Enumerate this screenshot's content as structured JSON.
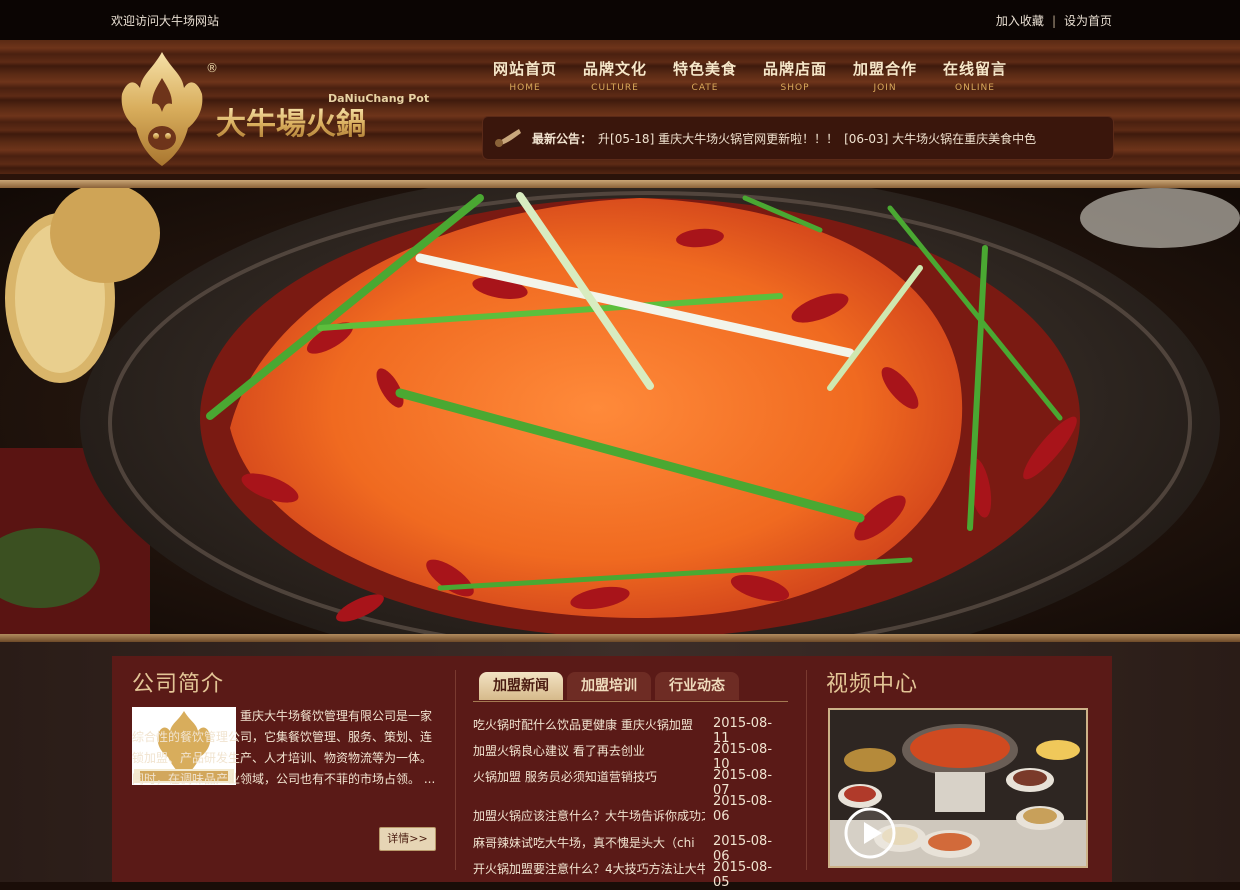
{
  "topbar": {
    "welcome": "欢迎访问大牛场网站",
    "add_favorite": "加入收藏",
    "separator": "|",
    "set_homepage": "设为首页"
  },
  "logo": {
    "brand_cn": "大牛場火鍋",
    "brand_en": "DaNiuChang Pot",
    "registered": "®"
  },
  "nav": {
    "items": [
      {
        "cn": "网站首页",
        "en": "HOME"
      },
      {
        "cn": "品牌文化",
        "en": "CULTURE"
      },
      {
        "cn": "特色美食",
        "en": "CATE"
      },
      {
        "cn": "品牌店面",
        "en": "SHOP"
      },
      {
        "cn": "加盟合作",
        "en": "JOIN"
      },
      {
        "cn": "在线留言",
        "en": "ONLINE"
      }
    ]
  },
  "notice": {
    "label": "最新公告：",
    "items": [
      "升[05-18] 重庆大牛场火锅官网更新啦！！！",
      "[06-03] 大牛场火锅在重庆美食中色"
    ]
  },
  "company": {
    "title": "公司简介",
    "intro": "重庆大牛场餐饮管理有限公司是一家综合性的餐饮管理公司，它集餐饮管理、服务、策划、连锁加盟、产品研发生产、人才培训、物资物流等为一体。同时，在调味品产业领域，公司也有不菲的市场占领。 ...",
    "more": "详情>>"
  },
  "news": {
    "tabs": [
      "加盟新闻",
      "加盟培训",
      "行业动态"
    ],
    "rows": [
      {
        "title": "吃火锅时配什么饮品更健康 重庆火锅加盟",
        "date": "2015-08-11"
      },
      {
        "title": "加盟火锅良心建议 看了再去创业",
        "date": "2015-08-10"
      },
      {
        "title": "火锅加盟 服务员必须知道营销技巧",
        "date": "2015-08-07"
      },
      {
        "title": "加盟火锅应该注意什么？大牛场告诉你成功之",
        "date": "2015-08-06"
      },
      {
        "title": "麻哥辣妹试吃大牛场，真不愧是头大（chi",
        "date": "2015-08-06"
      },
      {
        "title": "开火锅加盟要注意什么？4大技巧方法让大牛",
        "date": "2015-08-05"
      }
    ]
  },
  "video": {
    "title": "视频中心"
  },
  "colors": {
    "panel": "#5a1a17",
    "gold": "#e3c596",
    "wood": "#5a2a14"
  }
}
